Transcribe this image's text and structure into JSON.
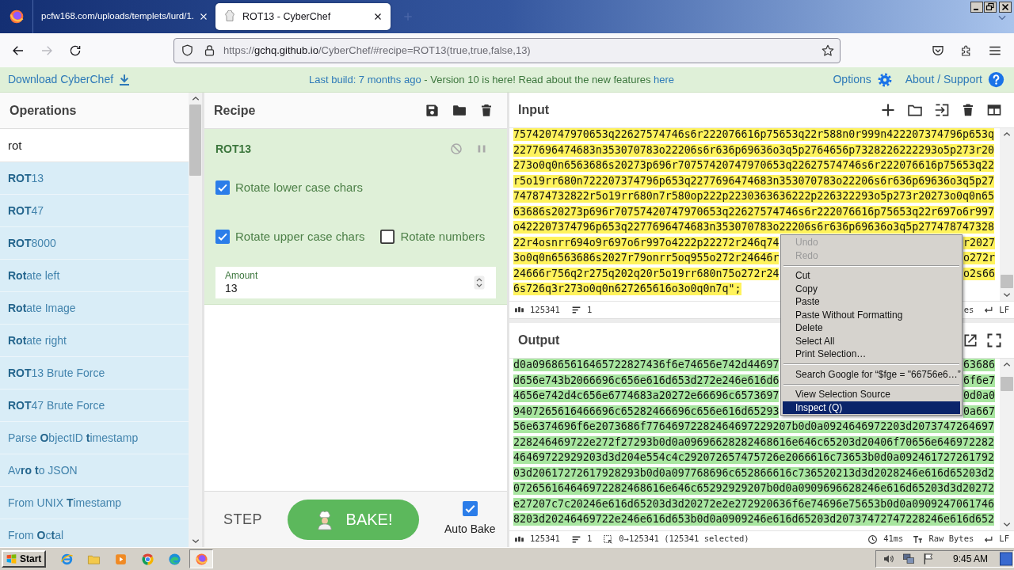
{
  "browser": {
    "tabs": [
      {
        "title": "pcfw168.com/uploads/templets/lurd/1.",
        "selected": false
      },
      {
        "title": "ROT13 - CyberChef",
        "selected": true
      }
    ],
    "nav": [
      {
        "kind": "back",
        "disabled": false
      },
      {
        "kind": "forward",
        "disabled": true
      },
      {
        "kind": "reload",
        "disabled": false
      }
    ],
    "url": {
      "scheme": "https://",
      "host": "gchq.github.io",
      "path": "/CyberChef/#recipe=ROT13(true,true,false,13)"
    }
  },
  "banner": {
    "download": "Download CyberChef",
    "build": "Last build: 7 months ago",
    "notice": "- Version 10 is here! Read about the new features",
    "notice_link": "here",
    "options": "Options",
    "about": "About / Support"
  },
  "operations": {
    "title": "Operations",
    "search": "rot",
    "items": [
      "**ROT**13",
      "**ROT**47",
      "**ROT**8000",
      "**Rot**ate left",
      "**Rot**ate Image",
      "**Rot**ate right",
      "**ROT**13 Brute Force",
      "**ROT**47 Brute Force",
      "Parse **O**bjectID **t**imestamp",
      "Av**ro** **t**o JSON",
      "From UNIX **T**imestamp",
      "From **O**c**t**al"
    ]
  },
  "recipe": {
    "title": "Recipe",
    "operation": {
      "name": "ROT13",
      "args": [
        {
          "kind": "checkbox",
          "label": "Rotate lower case chars",
          "checked": true
        },
        {
          "kind": "checkbox",
          "label": "Rotate upper case chars",
          "checked": true
        },
        {
          "kind": "checkbox",
          "label": "Rotate numbers",
          "checked": false
        },
        {
          "kind": "number",
          "label": "Amount",
          "value": "13"
        }
      ]
    }
  },
  "bake": {
    "step": "STEP",
    "bake": "BAKE!",
    "auto_bake": {
      "label": "Auto Bake",
      "checked": true
    }
  },
  "input": {
    "title": "Input",
    "lines": [
      [
        "757420747970653q22627574746s6r222076616p75653q22r588n0r999n422207374796p653q"
      ],
      [
        "2277696474683n353070783o22206s6r636p69636o3q5p2764656p7328226222293o5p273r20"
      ],
      [
        "273o0q0n6563686s20273p696r70757420747970653q22627574746s6r222076616p75653q22"
      ],
      [
        "r5o19rr680n722207374796p653q2277696474683n353070783o22206s6r636p69636o3q5p27"
      ],
      [
        "747874732822r5o19rr680n7r580op222p2230363636222p226322293o5p273r20273o0q0n65"
      ],
      [
        "63686s20273p696r70757420747970653q22627574746s6r222076616p75653q22r697o6r997"
      ],
      [
        "o422207374796p653q2277696474683n353070783o22206s6r636p69636o3q5p277478747328"
      ],
      [
        "22r4osnrr694o9r697o6r997o4222p22272r246q74",
        "r2027"
      ],
      [
        "3o0q0n6563686s2027r79onrr5oq955o272r24646r",
        "o272r"
      ],
      [
        "24666r756q2r275q202q20r5o19rr680n75o272r24",
        "o2s66"
      ],
      [
        "6s726q3r273o0q0n627265616o3o0q0n7q\";"
      ]
    ],
    "status": {
      "length": "125341",
      "lines": "1",
      "format": "es",
      "eol": "LF"
    }
  },
  "output": {
    "title": "Output",
    "lines": [
      [
        "d0a096865616465722827436f6e74656e742d44697",
        "63686"
      ],
      [
        "d656e743b2066696c656e616d653d272e246e616d6",
        "6f6e7"
      ],
      [
        "4656e742d4c656e6774683a20272e66696c6573697",
        "0d0a0"
      ],
      [
        "9407265616466696c65282466696c656e616d65293",
        "0a667"
      ],
      [
        "56e6374696f6e2073686f77646972282464697229207b0d0a0924646972203d2073747264697"
      ],
      [
        "228246469722e272f27293b0d0a09696628282468616e646c65203d20406f70656e646972282"
      ],
      [
        "46469722929203d3d204e554c4c292072657475726e2066616c73653b0d0a092461727261792"
      ],
      [
        "03d20617272617928293b0d0a097768696c652866616c736520213d3d2028246e616d65203d2"
      ],
      [
        "072656164646972282468616e646c65292929207b0d0a0909696628246e616d65203d3d20272"
      ],
      [
        "e27207c7c20246e616d65203d3d20272e2e272920636f6e74696e75653b0d0a0909247061746"
      ],
      [
        "8203d20246469722e246e616d653b0d0a0909246e616d65203d20737472747228246e616d652"
      ]
    ],
    "status": {
      "length": "125341",
      "lines": "1",
      "selection": "0→125341 (125341 selected)",
      "time": "41ms",
      "format": "Raw Bytes",
      "eol": "LF"
    }
  },
  "context_menu": {
    "items": [
      {
        "kind": "item",
        "label": "Undo",
        "disabled": true,
        "selected": false
      },
      {
        "kind": "item",
        "label": "Redo",
        "disabled": true,
        "selected": false
      },
      {
        "kind": "separator"
      },
      {
        "kind": "item",
        "label": "Cut",
        "disabled": false,
        "selected": false
      },
      {
        "kind": "item",
        "label": "Copy",
        "disabled": false,
        "selected": false
      },
      {
        "kind": "item",
        "label": "Paste",
        "disabled": false,
        "selected": false
      },
      {
        "kind": "item",
        "label": "Paste Without Formatting",
        "disabled": false,
        "selected": false
      },
      {
        "kind": "item",
        "label": "Delete",
        "disabled": false,
        "selected": false
      },
      {
        "kind": "item",
        "label": "Select All",
        "disabled": false,
        "selected": false
      },
      {
        "kind": "item",
        "label": "Print Selection…",
        "disabled": false,
        "selected": false
      },
      {
        "kind": "separator"
      },
      {
        "kind": "item",
        "label": "Search Google for “$fge = \"66756e6…”",
        "disabled": false,
        "selected": false
      },
      {
        "kind": "separator"
      },
      {
        "kind": "item",
        "label": "View Selection Source",
        "disabled": false,
        "selected": false
      },
      {
        "kind": "item",
        "label": "Inspect (Q)",
        "disabled": false,
        "selected": true
      }
    ]
  },
  "taskbar": {
    "start": "Start",
    "apps": [
      {
        "kind": "ie",
        "active": false
      },
      {
        "kind": "folder",
        "active": false
      },
      {
        "kind": "media",
        "active": false
      },
      {
        "kind": "chrome",
        "active": false
      },
      {
        "kind": "edge",
        "active": false
      },
      {
        "kind": "firefox",
        "active": true
      }
    ],
    "clock": "9:45 AM"
  }
}
